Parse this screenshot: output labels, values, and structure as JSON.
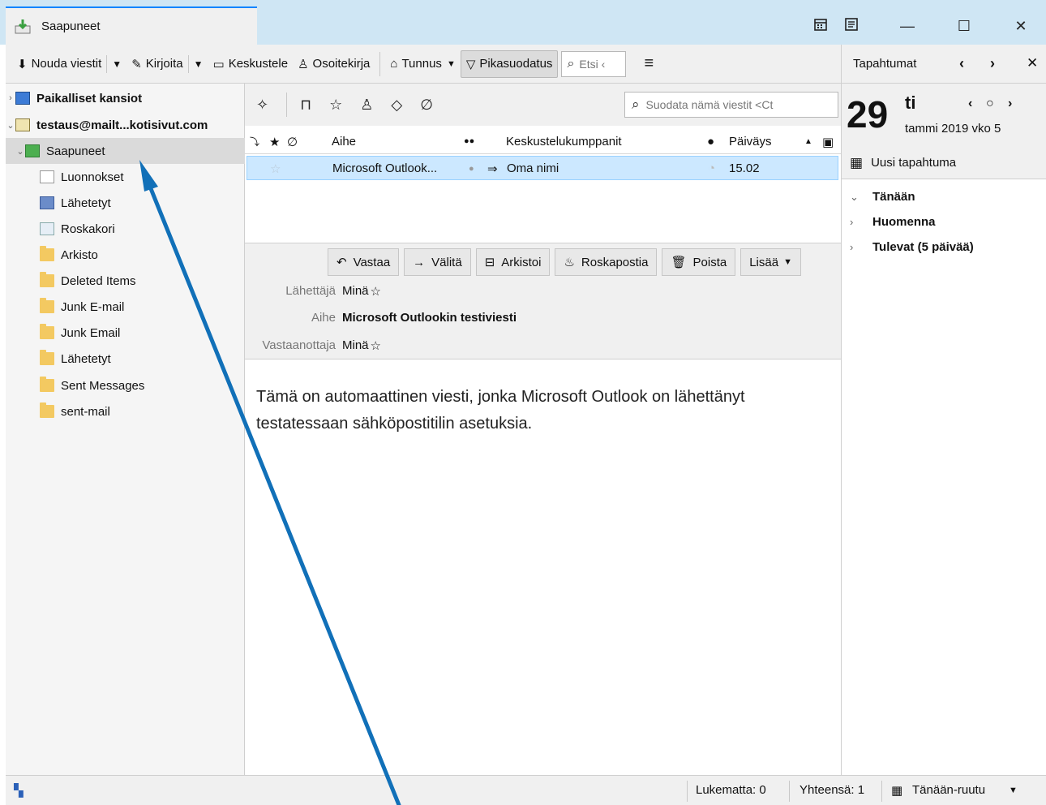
{
  "window": {
    "tab_label": "Saapuneet",
    "icons": [
      "calendar-icon",
      "tasks-icon"
    ],
    "min_label": "—",
    "max_label": "☐",
    "close_label": "✕"
  },
  "toolbar": {
    "get_messages": "Nouda viestit",
    "write": "Kirjoita",
    "chat": "Keskustele",
    "address_book": "Osoitekirja",
    "tag": "Tunnus",
    "quick_filter": "Pikasuodatus",
    "search_placeholder": "Etsi ‹"
  },
  "today_header": {
    "label": "Tapahtumat"
  },
  "folders": {
    "local": "Paikalliset kansiot",
    "account": "testaus@mailt...kotisivut.com",
    "items": [
      {
        "label": "Saapuneet"
      },
      {
        "label": "Luonnokset"
      },
      {
        "label": "Lähetetyt"
      },
      {
        "label": "Roskakori"
      },
      {
        "label": "Arkisto"
      },
      {
        "label": "Deleted Items"
      },
      {
        "label": "Junk E-mail"
      },
      {
        "label": "Junk Email"
      },
      {
        "label": "Lähetetyt"
      },
      {
        "label": "Sent Messages"
      },
      {
        "label": "sent-mail"
      }
    ]
  },
  "listbar": {
    "filter_placeholder": "Suodata nämä viestit <Ct"
  },
  "columns": {
    "subject": "Aihe",
    "correspondents": "Keskustelukumppanit",
    "date": "Päiväys"
  },
  "messages": [
    {
      "subject": "Microsoft Outlook...",
      "correspondent": "Oma nimi",
      "date": "15.02"
    }
  ],
  "actions": {
    "reply": "Vastaa",
    "forward": "Välitä",
    "archive": "Arkistoi",
    "junk": "Roskapostia",
    "delete": "Poista",
    "more": "Lisää"
  },
  "header": {
    "from_label": "Lähettäjä",
    "from_value": "Minä",
    "subject_label": "Aihe",
    "subject_value": "Microsoft Outlookin testiviesti",
    "to_label": "Vastaanottaja",
    "to_value": "Minä"
  },
  "body": {
    "text": "Tämä on automaattinen viesti, jonka Microsoft Outlook on lähettänyt testatessaan sähköpostitilin asetuksia."
  },
  "today": {
    "day_number": "29",
    "day_name": "ti",
    "date_line": "tammi 2019   vko 5",
    "new_event": "Uusi tapahtuma",
    "sections": [
      {
        "label": "Tänään",
        "expanded": true
      },
      {
        "label": "Huomenna",
        "expanded": false
      },
      {
        "label": "Tulevat (5 päivää)",
        "expanded": false
      }
    ]
  },
  "status": {
    "unread": "Lukematta: 0",
    "total": "Yhteensä: 1",
    "today_pane": "Tänään-ruutu"
  },
  "colors": {
    "accent": "#0a84ff",
    "arrow": "#1170b8",
    "selection": "#cce8ff"
  }
}
